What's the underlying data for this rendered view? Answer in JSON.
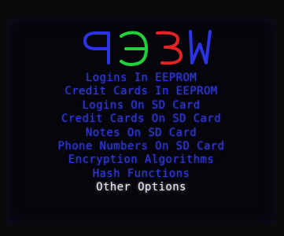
{
  "logo": {
    "text": "ꟼЭЄW",
    "colors": [
      "#2a33e6",
      "#21d13a",
      "#e02424",
      "#2a33e6"
    ]
  },
  "menu": {
    "items": [
      "Logins In EEPROM",
      "Credit Cards In EEPROM",
      "Logins On SD Card",
      "Credit Cards On SD Card",
      "Notes On SD Card",
      "Phone Numbers On SD Card",
      "Encryption Algorithms",
      "Hash Functions",
      "Other Options"
    ],
    "selected_index": 8,
    "item_color": "#2f37d9",
    "selected_color": "#eef0ff"
  }
}
